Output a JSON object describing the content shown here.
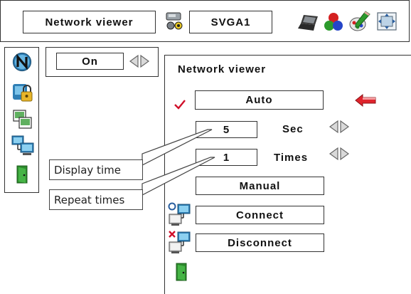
{
  "top_bar": {
    "title": "Network viewer",
    "mode": "SVGA1",
    "icons": [
      "projector-icon",
      "laptop-icon",
      "color-balls-icon",
      "pencil-palette-icon",
      "screen-adjust-icon"
    ]
  },
  "sidebar": {
    "items": [
      {
        "icon": "network-n-icon"
      },
      {
        "icon": "lock-security-icon"
      },
      {
        "icon": "copy-screen-icon"
      },
      {
        "icon": "network-monitor-icon"
      },
      {
        "icon": "exit-door-icon"
      }
    ]
  },
  "selector": {
    "value": "On"
  },
  "panel": {
    "title": "Network viewer",
    "auto_label": "Auto",
    "interval_value": "5",
    "interval_unit": "Sec",
    "repeat_value": "1",
    "repeat_unit": "Times",
    "manual_label": "Manual",
    "connect_label": "Connect",
    "disconnect_label": "Disconnect"
  },
  "callouts": {
    "display_time": "Display time",
    "repeat_times": "Repeat times"
  },
  "colors": {
    "check": "#d0102a",
    "arrow": "#e0242c",
    "border": "#333333"
  }
}
